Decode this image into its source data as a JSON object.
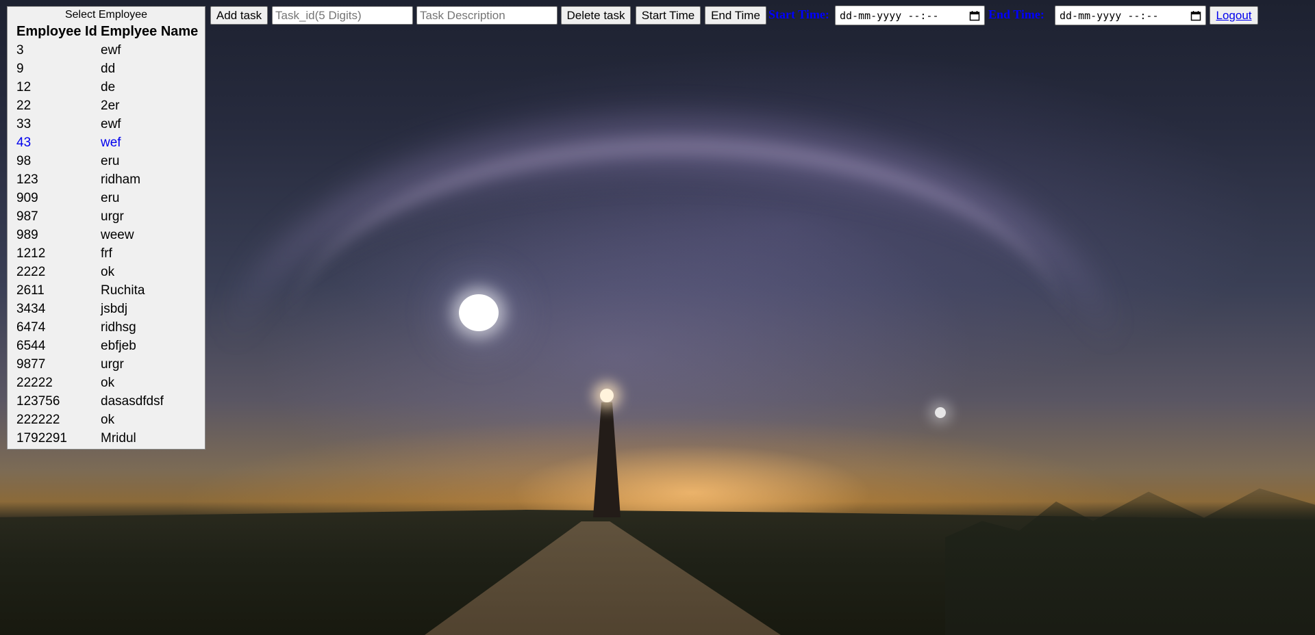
{
  "employee_panel": {
    "title": "Select Employee",
    "headers": {
      "id": "Employee Id",
      "name": "Emplyee Name"
    },
    "rows": [
      {
        "id": "3",
        "name": "ewf"
      },
      {
        "id": "9",
        "name": "dd"
      },
      {
        "id": "12",
        "name": "de"
      },
      {
        "id": "22",
        "name": "2er"
      },
      {
        "id": "33",
        "name": "ewf"
      },
      {
        "id": "43",
        "name": "wef"
      },
      {
        "id": "98",
        "name": "eru"
      },
      {
        "id": "123",
        "name": "ridham"
      },
      {
        "id": "909",
        "name": "eru"
      },
      {
        "id": "987",
        "name": "urgr"
      },
      {
        "id": "989",
        "name": "weew"
      },
      {
        "id": "1212",
        "name": "frf"
      },
      {
        "id": "2222",
        "name": "ok"
      },
      {
        "id": "2611",
        "name": "Ruchita"
      },
      {
        "id": "3434",
        "name": "jsbdj"
      },
      {
        "id": "6474",
        "name": "ridhsg"
      },
      {
        "id": "6544",
        "name": "ebfjeb"
      },
      {
        "id": "9877",
        "name": "urgr"
      },
      {
        "id": "22222",
        "name": "ok"
      },
      {
        "id": "123756",
        "name": "dasasdfdsf"
      },
      {
        "id": "222222",
        "name": "ok"
      },
      {
        "id": "1792291",
        "name": "Mridul"
      }
    ],
    "selected_id": "43",
    "selected_color": "#0000ee"
  },
  "toolbar": {
    "add_task_label": "Add task",
    "task_id_placeholder": "Task_id(5 Digits)",
    "task_id_value": "",
    "task_desc_placeholder": "Task Description",
    "task_desc_value": "",
    "delete_task_label": "Delete task",
    "start_time_button_label": "Start Time",
    "end_time_button_label": "End Time",
    "start_time_label": "Start Time:",
    "start_time_value": "dd-mm-yyyy --:--",
    "end_time_label": "End Time:",
    "end_time_value": "dd-mm-yyyy --:--",
    "logout_label": "Logout",
    "label_color": "#0000ff",
    "calendar_icon": "calendar-icon"
  }
}
